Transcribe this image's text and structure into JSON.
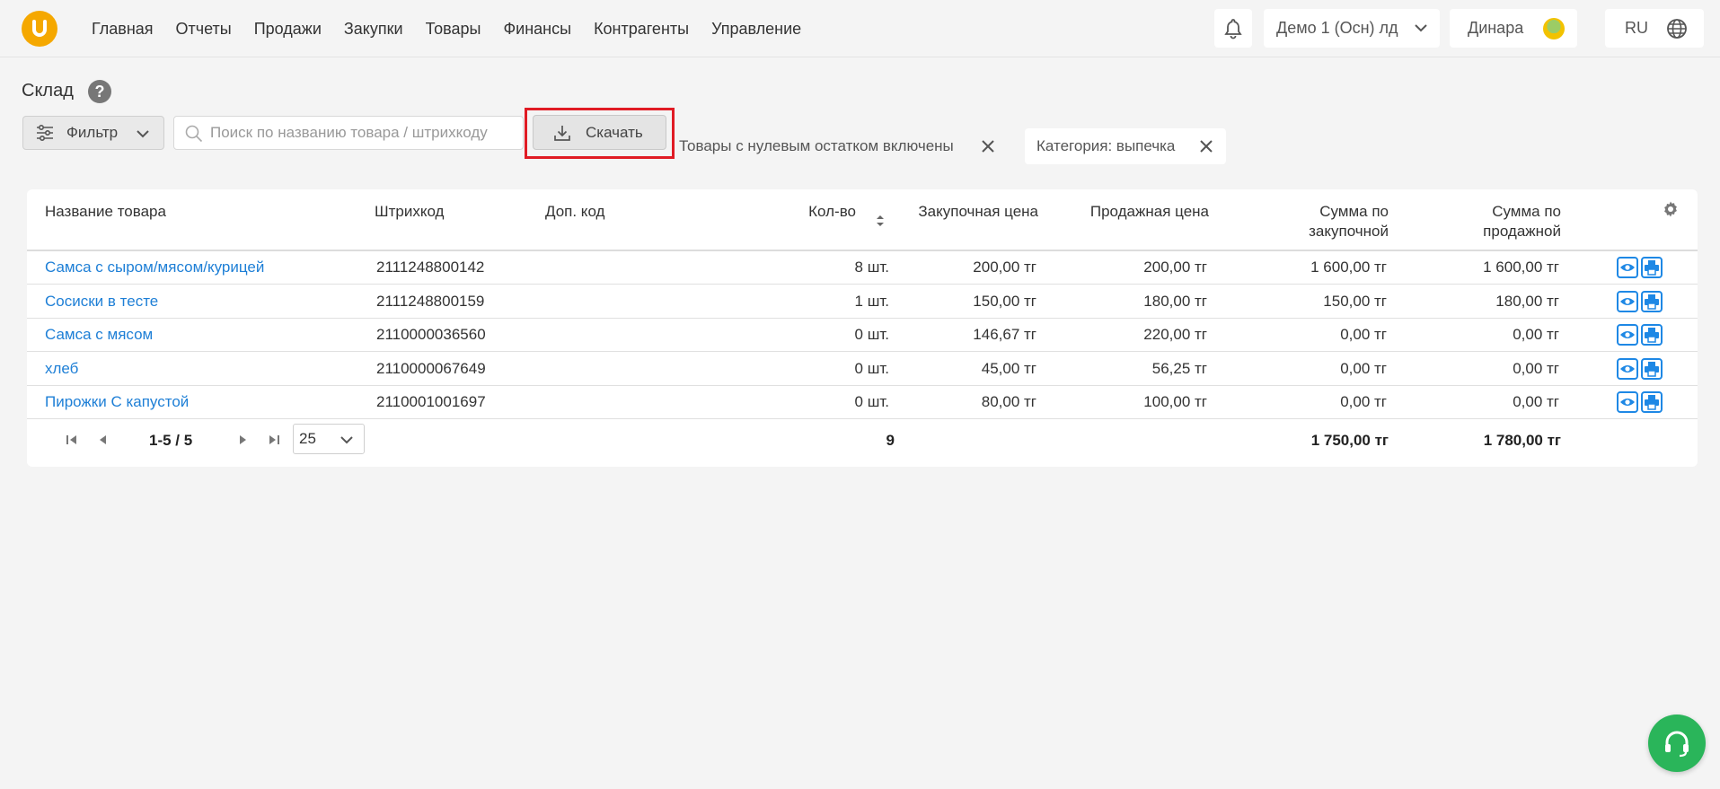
{
  "nav": {
    "items": [
      "Главная",
      "Отчеты",
      "Продажи",
      "Закупки",
      "Товары",
      "Финансы",
      "Контрагенты",
      "Управление"
    ]
  },
  "header": {
    "org": "Демо 1 (Осн) лд",
    "user": "Динара",
    "lang": "RU"
  },
  "page": {
    "title": "Склад"
  },
  "toolbar": {
    "filter_label": "Фильтр",
    "search_placeholder": "Поиск по названию товара / штрихкоду",
    "download_label": "Скачать",
    "chips": [
      "Товары с нулевым остатком включены",
      "Категория: выпечка"
    ]
  },
  "table": {
    "columns": {
      "name": "Название товара",
      "barcode": "Штрихкод",
      "extra_code": "Доп. код",
      "qty": "Кол-во",
      "purchase_price": "Закупочная цена",
      "sale_price": "Продажная цена",
      "sum_purchase_1": "Сумма по",
      "sum_purchase_2": "закупочной",
      "sum_sale_1": "Сумма по",
      "sum_sale_2": "продажной"
    },
    "rows": [
      {
        "name": "Самса с сыром/мясом/курицей",
        "barcode": "2111248800142",
        "extra": "",
        "qty": "8 шт.",
        "purchase": "200,00 тг",
        "sale": "200,00 тг",
        "sum_purchase": "1 600,00 тг",
        "sum_sale": "1 600,00 тг"
      },
      {
        "name": "Сосиски в тесте",
        "barcode": "2111248800159",
        "extra": "",
        "qty": "1 шт.",
        "purchase": "150,00 тг",
        "sale": "180,00 тг",
        "sum_purchase": "150,00 тг",
        "sum_sale": "180,00 тг"
      },
      {
        "name": "Самса с мясом",
        "barcode": "2110000036560",
        "extra": "",
        "qty": "0 шт.",
        "purchase": "146,67 тг",
        "sale": "220,00 тг",
        "sum_purchase": "0,00 тг",
        "sum_sale": "0,00 тг"
      },
      {
        "name": "хлеб",
        "barcode": "2110000067649",
        "extra": "",
        "qty": "0 шт.",
        "purchase": "45,00 тг",
        "sale": "56,25 тг",
        "sum_purchase": "0,00 тг",
        "sum_sale": "0,00 тг"
      },
      {
        "name": "Пирожки С капустой",
        "barcode": "2110001001697",
        "extra": "",
        "qty": "0 шт.",
        "purchase": "80,00 тг",
        "sale": "100,00 тг",
        "sum_purchase": "0,00 тг",
        "sum_sale": "0,00 тг"
      }
    ]
  },
  "pager": {
    "range": "1-5 / 5",
    "page_size": "25"
  },
  "totals": {
    "qty": "9",
    "sum_purchase": "1 750,00 тг",
    "sum_sale": "1 780,00 тг"
  },
  "icons": {
    "logo": "logo-icon",
    "bell": "bell-icon",
    "globe": "globe-icon",
    "help": "help-icon",
    "filter": "filter-icon",
    "search": "search-icon",
    "download": "download-icon",
    "close": "close-icon",
    "view": "eye-icon",
    "print": "print-icon",
    "gear": "gear-icon",
    "support": "headset-icon"
  },
  "colors": {
    "brand": "#f5a800",
    "link": "#1e7fd6",
    "highlight": "#e01b24",
    "support": "#2ab55a"
  }
}
